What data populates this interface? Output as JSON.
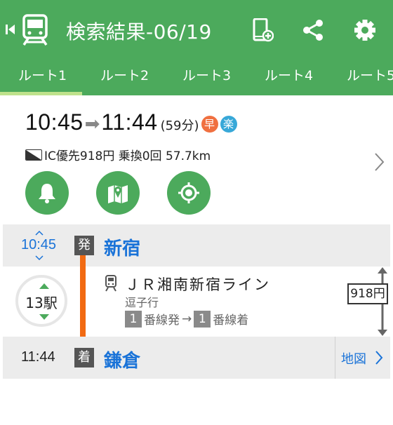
{
  "header": {
    "title": "検索結果-06/19",
    "bg_color": "#4caa5c"
  },
  "tabs": [
    {
      "label": "ルート1",
      "active": true
    },
    {
      "label": "ルート2",
      "active": false
    },
    {
      "label": "ルート3",
      "active": false
    },
    {
      "label": "ルート4",
      "active": false
    },
    {
      "label": "ルート5",
      "active": false
    }
  ],
  "summary": {
    "departure": "10:45",
    "arrow": "➡",
    "arrival": "11:44",
    "duration": "(59分)",
    "badge_fast": "早",
    "badge_easy": "楽",
    "fare_info": "IC優先918円 乗換0回 57.7km",
    "actions": [
      "bell-icon",
      "map-pin-icon",
      "location-target-icon"
    ]
  },
  "route": {
    "departure_time": "10:45",
    "departure_badge": "発",
    "departure_station": "新宿",
    "stops": "13駅",
    "line_name": "ＪＲ湘南新宿ライン",
    "direction": "逗子行",
    "dep_platform": "1",
    "dep_platform_suffix": "番線発",
    "arr_platform": "1",
    "arr_platform_suffix": "番線着",
    "platform_arrow": "→",
    "fare": "918円",
    "arrival_time": "11:44",
    "arrival_badge": "着",
    "arrival_station": "鎌倉",
    "map_label": "地図",
    "line_color": "#f26a12",
    "link_color": "#1a73d8"
  }
}
